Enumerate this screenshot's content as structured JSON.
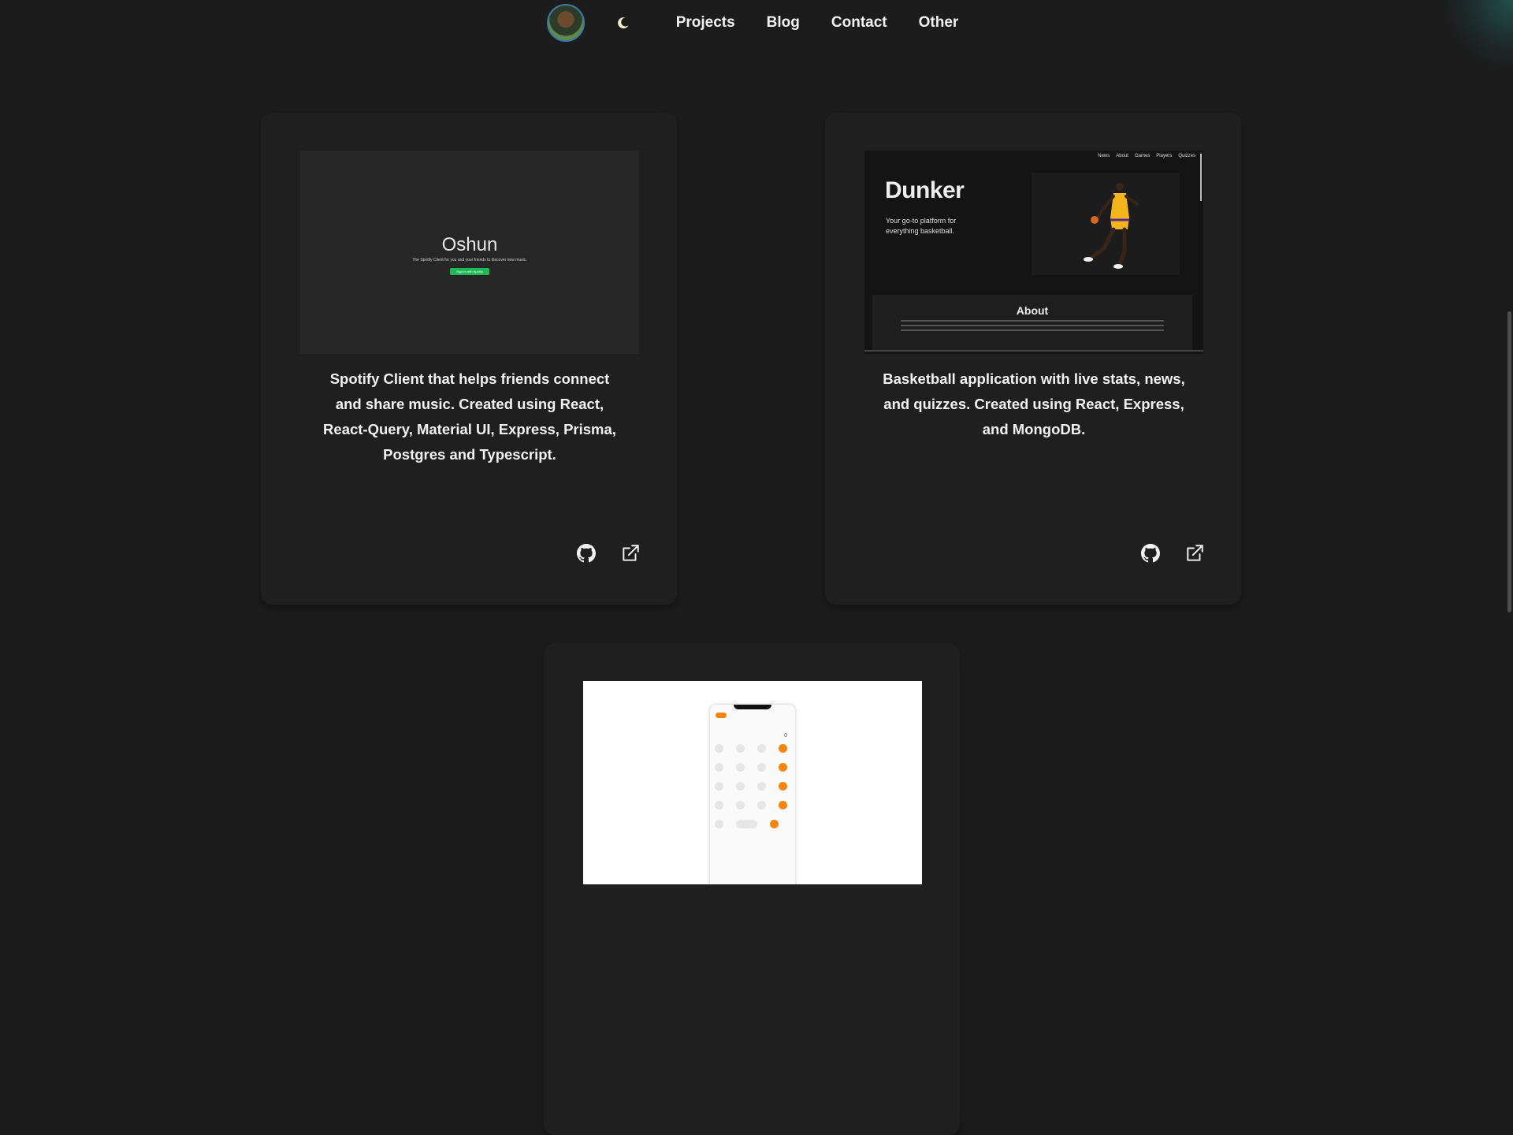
{
  "nav": {
    "links": [
      "Projects",
      "Blog",
      "Contact",
      "Other"
    ]
  },
  "projects": [
    {
      "thumb": {
        "title": "Oshun",
        "subtitle": "The Spotify Client for you and your friends to discover new music.",
        "button": "Sign in with Spotify"
      },
      "description": "Spotify Client that helps friends connect and share music. Created using React, React-Query, Material UI, Express, Prisma, Postgres and Typescript."
    },
    {
      "thumb": {
        "nav": [
          "News",
          "About",
          "Games",
          "Players",
          "Quizzes"
        ],
        "title": "Dunker",
        "tagline": "Your go-to platform for everything basketball.",
        "about": "About"
      },
      "description": "Basketball application with live stats, news, and quizzes. Created using React, Express, and MongoDB."
    },
    {
      "thumb": {
        "display": "0"
      }
    }
  ],
  "colors": {
    "background": "#1c1c1c",
    "card": "#1f1f1f",
    "spotify_green": "#1db954",
    "calc_orange": "#f2860f"
  }
}
